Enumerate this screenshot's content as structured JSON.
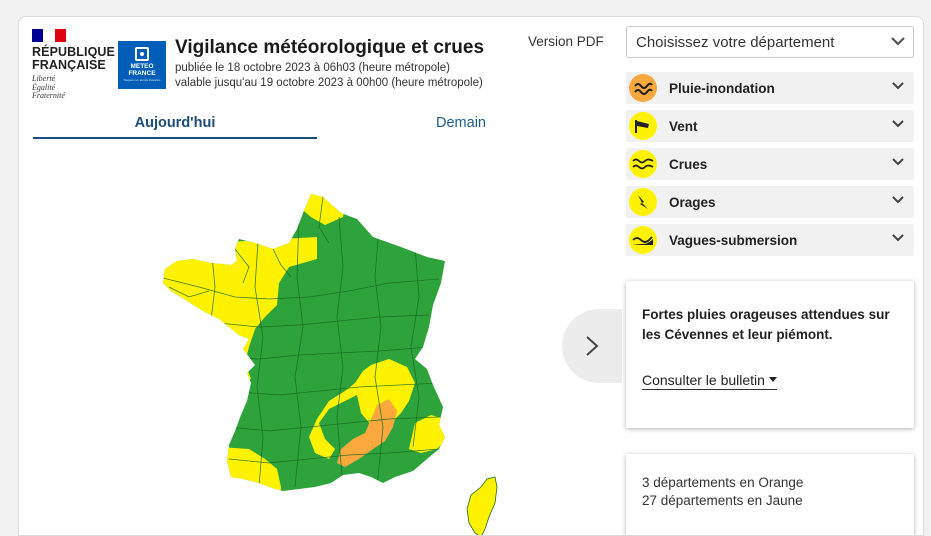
{
  "header": {
    "republic_name_line1": "RÉPUBLIQUE",
    "republic_name_line2": "FRANÇAISE",
    "motto": [
      "Liberté",
      "Égalité",
      "Fraternité"
    ],
    "meteo_logo_text": "METEO\nFRANCE",
    "meteo_logo_subtext": "Toujours un temps d'avance",
    "title": "Vigilance météorologique et crues",
    "published": "publiée le 18 octobre 2023 à 06h03 (heure métropole)",
    "valid_until": "valable jusqu'au 19 octobre 2023 à 00h00 (heure métropole)",
    "pdf_link": "Version PDF"
  },
  "tabs": [
    {
      "label": "Aujourd'hui",
      "active": true
    },
    {
      "label": "Demain",
      "active": false
    }
  ],
  "map": {
    "colors": {
      "green": "#2ea33c",
      "yellow": "#fff200",
      "orange": "#f8a83c",
      "border": "#1b6a23"
    }
  },
  "department_select": {
    "placeholder": "Choisissez votre département"
  },
  "phenomena": [
    {
      "label": "Pluie-inondation",
      "icon": "rain-flood-icon",
      "color": "#f8a83c"
    },
    {
      "label": "Vent",
      "icon": "wind-icon",
      "color": "#fff200"
    },
    {
      "label": "Crues",
      "icon": "floods-icon",
      "color": "#fff200"
    },
    {
      "label": "Orages",
      "icon": "storm-icon",
      "color": "#fff200"
    },
    {
      "label": "Vagues-submersion",
      "icon": "waves-icon",
      "color": "#fff200"
    }
  ],
  "summary_card": {
    "text": "Fortes pluies orageuses attendues sur les Cévennes et leur piémont.",
    "bulletin_link": "Consulter le bulletin"
  },
  "counts_card": {
    "orange": "3 départements en Orange",
    "yellow": "27 départements en Jaune"
  },
  "colors": {
    "accent": "#1e4c7a",
    "flag_blue": "#000091",
    "flag_red": "#e1000f",
    "meteo_blue": "#005eb8"
  }
}
